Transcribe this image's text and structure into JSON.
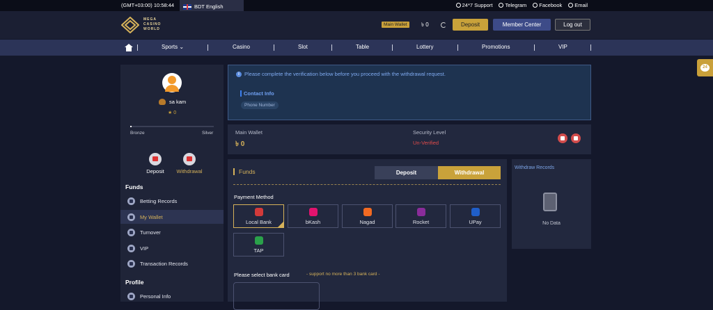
{
  "topbar": {
    "time": "(GMT+03:00) 10:58:44",
    "language": "BDT English",
    "links": [
      "24*7 Support",
      "Telegram",
      "Facebook",
      "Email"
    ]
  },
  "header": {
    "logo_text": [
      "MEGA",
      "CASINO",
      "WORLD"
    ],
    "wallet_label": "Main Wallet",
    "wallet_amount": "0",
    "deposit_button": "Deposit",
    "member_center_button": "Member Center",
    "logout_button": "Log out"
  },
  "nav": {
    "items": [
      "Sports ⌄",
      "Casino",
      "Slot",
      "Table",
      "Lottery",
      "Promotions",
      "VIP"
    ]
  },
  "sidebar": {
    "username": "sa kam",
    "level": "★ 0",
    "progress": 0.0,
    "progress_left": "Bronze",
    "progress_right": "Silver",
    "quick_actions": [
      "Deposit",
      "Withdrawal"
    ],
    "funds_title": "Funds",
    "funds_items": [
      "Betting Records",
      "My Wallet",
      "Turnover",
      "VIP",
      "Transaction Records"
    ],
    "profile_title": "Profile",
    "profile_items": [
      "Personal Info"
    ]
  },
  "verify": {
    "message": "Please complete the verification below before you proceed with the withdrawal request.",
    "contact_title": "Contact Info",
    "phone_chip": "Phone Number"
  },
  "wallet": {
    "main_label": "Main Wallet",
    "main_amount": "৳ 0",
    "security_label": "Security Level",
    "security_value": "Un-Verified"
  },
  "funds": {
    "title": "Funds",
    "tabs": [
      "Deposit",
      "Withdrawal"
    ],
    "payment_label": "Payment Method",
    "methods": [
      {
        "name": "Local Bank",
        "color": "#d23a3a"
      },
      {
        "name": "bKash",
        "color": "#e2136e"
      },
      {
        "name": "Nagad",
        "color": "#f26a22"
      },
      {
        "name": "Rocket",
        "color": "#8a2c9a"
      },
      {
        "name": "UPay",
        "color": "#1f5ec9"
      },
      {
        "name": "TAP",
        "color": "#2aa14a"
      }
    ],
    "select_bank": "Please select bank card",
    "select_note": "- support no more than 3 bank card -"
  },
  "records": {
    "title": "Withdraw Records",
    "empty": "No Data"
  }
}
